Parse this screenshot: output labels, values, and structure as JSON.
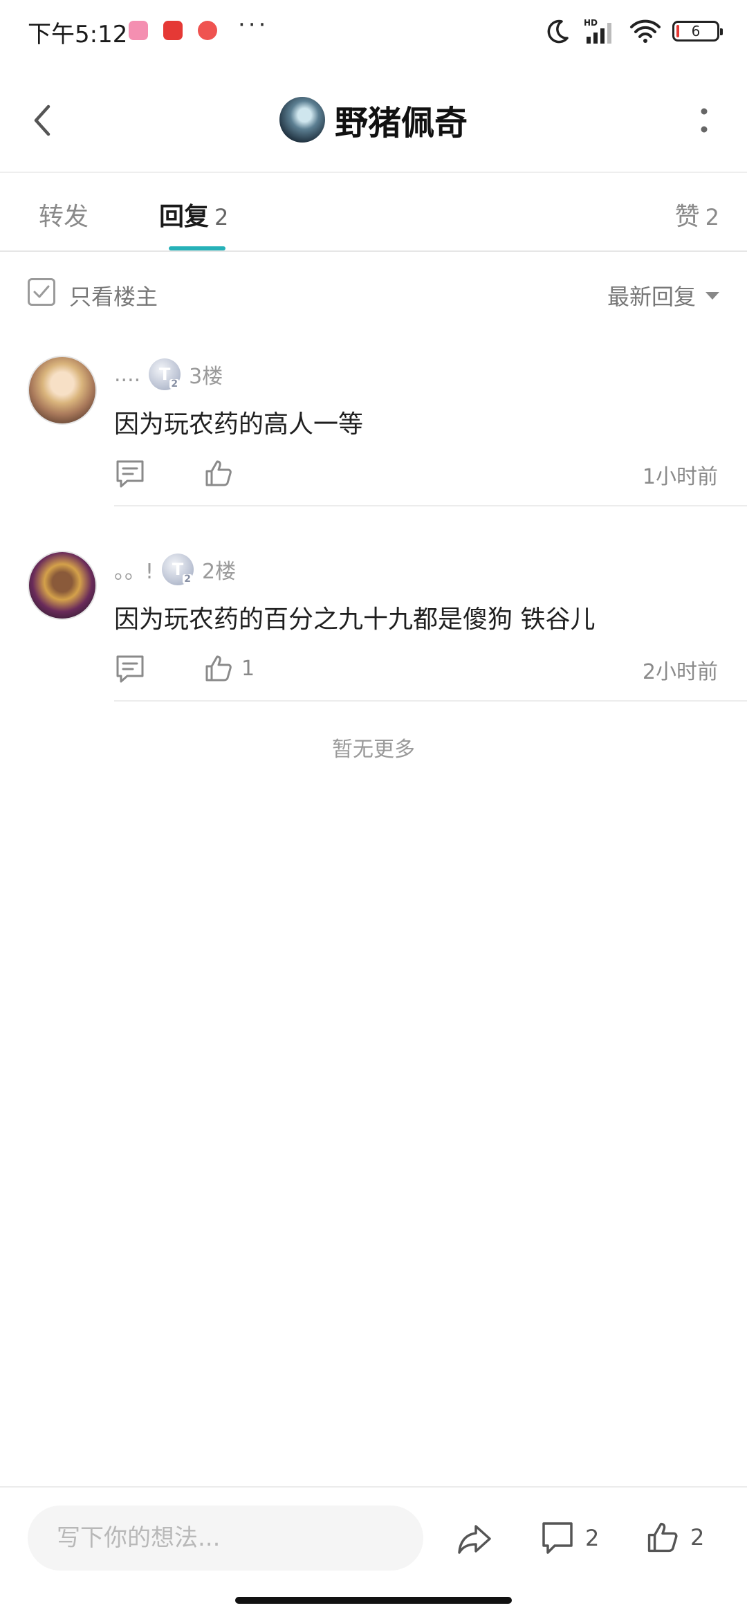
{
  "status_bar": {
    "time": "下午5:12",
    "notification_icons": [
      "video-app-icon",
      "shopping-app-icon",
      "news-app-icon"
    ],
    "more_indicator": "···",
    "battery_level": "6",
    "network": "HD",
    "icons": [
      "moon-icon",
      "signal-icon",
      "wifi-icon",
      "battery-icon"
    ]
  },
  "header": {
    "title": "野猪佩奇",
    "back_icon": "chevron-left-icon",
    "more_icon": "more-vertical-icon"
  },
  "tabs": [
    {
      "label": "转发",
      "count": "",
      "active": false
    },
    {
      "label": "回复",
      "count": "2",
      "active": true
    },
    {
      "label": "赞",
      "count": "2",
      "active": false
    }
  ],
  "accent_color": "#26b1b8",
  "filter": {
    "only_op_label": "只看楼主",
    "only_op_checked": false,
    "sort_label": "最新回复"
  },
  "replies": [
    {
      "username": "....",
      "level_badge": "T",
      "level_sub": "2",
      "floor": "3楼",
      "text": "因为玩农药的高人一等",
      "like_count": "",
      "time": "1小时前"
    },
    {
      "username": "。。!",
      "level_badge": "T",
      "level_sub": "2",
      "floor": "2楼",
      "text": "因为玩农药的百分之九十九都是傻狗 铁谷儿",
      "like_count": "1",
      "time": "2小时前"
    }
  ],
  "no_more_text": "暂无更多",
  "bottom_bar": {
    "input_placeholder": "写下你的想法...",
    "comment_count": "2",
    "like_count": "2"
  }
}
